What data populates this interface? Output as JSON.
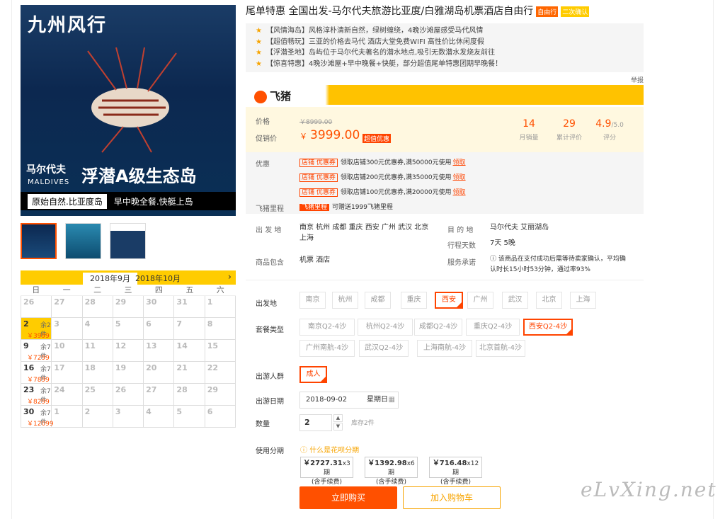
{
  "hero": {
    "logo": "九州风行",
    "loc_cn": "马尔代夫",
    "loc_en": "MALDIVES",
    "headline": "浮潜A级生态岛",
    "bar_white": "原始自然.比亚度岛",
    "bar_black": "早中晚全餐.快艇上岛"
  },
  "calendar": {
    "tab1": "2018年9月",
    "tab2": "2018年10月",
    "next": "›",
    "dow": [
      "日",
      "一",
      "二",
      "三",
      "四",
      "五",
      "六"
    ],
    "cells": [
      [
        "26",
        "",
        ""
      ],
      [
        "27",
        "",
        ""
      ],
      [
        "28",
        "",
        ""
      ],
      [
        "29",
        "",
        ""
      ],
      [
        "30",
        "",
        ""
      ],
      [
        "31",
        "",
        ""
      ],
      [
        "1",
        "",
        ""
      ],
      [
        "2",
        "余2件",
        "￥3999"
      ],
      [
        "3",
        "",
        ""
      ],
      [
        "4",
        "",
        ""
      ],
      [
        "5",
        "",
        ""
      ],
      [
        "6",
        "",
        ""
      ],
      [
        "7",
        "",
        ""
      ],
      [
        "8",
        "",
        ""
      ],
      [
        "9",
        "余7件",
        "￥7299"
      ],
      [
        "10",
        "",
        ""
      ],
      [
        "11",
        "",
        ""
      ],
      [
        "12",
        "",
        ""
      ],
      [
        "13",
        "",
        ""
      ],
      [
        "14",
        "",
        ""
      ],
      [
        "15",
        "",
        ""
      ],
      [
        "16",
        "余7件",
        "￥7899"
      ],
      [
        "17",
        "",
        ""
      ],
      [
        "18",
        "",
        ""
      ],
      [
        "19",
        "",
        ""
      ],
      [
        "20",
        "",
        ""
      ],
      [
        "21",
        "",
        ""
      ],
      [
        "22",
        "",
        ""
      ],
      [
        "23",
        "余7件",
        "￥8299"
      ],
      [
        "24",
        "",
        ""
      ],
      [
        "25",
        "",
        ""
      ],
      [
        "26",
        "",
        ""
      ],
      [
        "27",
        "",
        ""
      ],
      [
        "28",
        "",
        ""
      ],
      [
        "29",
        "",
        ""
      ],
      [
        "30",
        "余7件",
        "￥12099"
      ],
      [
        "1",
        "",
        ""
      ],
      [
        "2",
        "",
        ""
      ],
      [
        "3",
        "",
        ""
      ],
      [
        "4",
        "",
        ""
      ],
      [
        "5",
        "",
        ""
      ],
      [
        "6",
        "",
        ""
      ]
    ]
  },
  "product": {
    "title": "尾单特惠 全国出发-马尔代夫旅游比亚度/白雅湖岛机票酒店自由行",
    "tag1": "自由行",
    "tag2": "二次确认"
  },
  "highlights": [
    "【风情海岛】风格淳朴清新自然，绿树缠绕，4晚沙滩屋感受马代风情",
    "【超值畅玩】三亚的价格去马代 酒店大堂免费WIFI 高性价比休闲度假",
    "【浮潜圣地】岛屿位于马尔代夫著名的潜水地点,吸引无数潜水发烧友前往",
    "【惊喜特惠】4晚沙滩屋+早中晚餐+快艇，部分超值尾单特惠团期早晚餐！"
  ],
  "report": "举报",
  "brand": "飞猪",
  "price": {
    "label": "价格",
    "old": "￥8999.00",
    "promo_label": "促销价",
    "cur_sym": "￥",
    "current": "3999.00",
    "badge": "超值优惠"
  },
  "stats": [
    {
      "n": "14",
      "k": "月销量"
    },
    {
      "n": "29",
      "k": "累计评价"
    },
    {
      "n": "4.9",
      "u": "/5.0",
      "k": "评分"
    }
  ],
  "coupon": {
    "label": "优惠",
    "tag": "店铺 优惠券",
    "items": [
      "领取店铺300元优惠券,满50000元使用",
      "领取店铺200元优惠券,满35000元使用",
      "领取店铺100元优惠券,满20000元使用"
    ],
    "link": "领取",
    "miles_label": "飞猪里程",
    "miles_tag": "飞猪里程",
    "miles_text": "可赠送1999飞猪里程"
  },
  "info": {
    "from_label": "出 发 地",
    "from_val": "南京  杭州  成都  重庆  西安  广州  武汉  北京  上海",
    "dest_label": "目 的 地",
    "dest_val": "马尔代夫   艾丽湖岛",
    "days_label": "行程天数",
    "days_val": "7天   5晚",
    "incl_label": "商品包含",
    "incl_val": "机票   酒店",
    "svc_label": "服务承诺",
    "svc_val": "该商品在支付成功后需等待卖家确认，平均确认时长15小时53分钟，通过率93%"
  },
  "options": {
    "from_label": "出发地",
    "cities": [
      "南京",
      "杭州",
      "成都",
      "重庆",
      "西安",
      "广州",
      "武汉",
      "北京",
      "上海"
    ],
    "pkg_label": "套餐类型",
    "pkgs": [
      "南京Q2-4沙",
      "杭州Q2-4沙",
      "成都Q2-4沙",
      "重庆Q2-4沙",
      "西安Q2-4沙",
      "广州南航-4沙",
      "武汉Q2-4沙",
      "上海南航-4沙",
      "北京首航-4沙"
    ],
    "people_label": "出游人群",
    "people": "成人",
    "date_label": "出游日期",
    "date": "2018-09-02",
    "weekday": "星期日",
    "qty_label": "数量",
    "qty": "2",
    "stock": "库存2件",
    "inst_label": "使用分期",
    "inst_help": "什么是花呗分期",
    "inst": [
      {
        "a": "￥2727.31",
        "t": "x3期",
        "f": "(含手续费)"
      },
      {
        "a": "￥1392.98",
        "t": "x6期",
        "f": "(含手续费)"
      },
      {
        "a": "￥716.48",
        "t": "x12期",
        "f": "(含手续费)"
      }
    ],
    "buy": "立即购买",
    "cart": "加入购物车"
  },
  "watermark": "eLvXing.net"
}
